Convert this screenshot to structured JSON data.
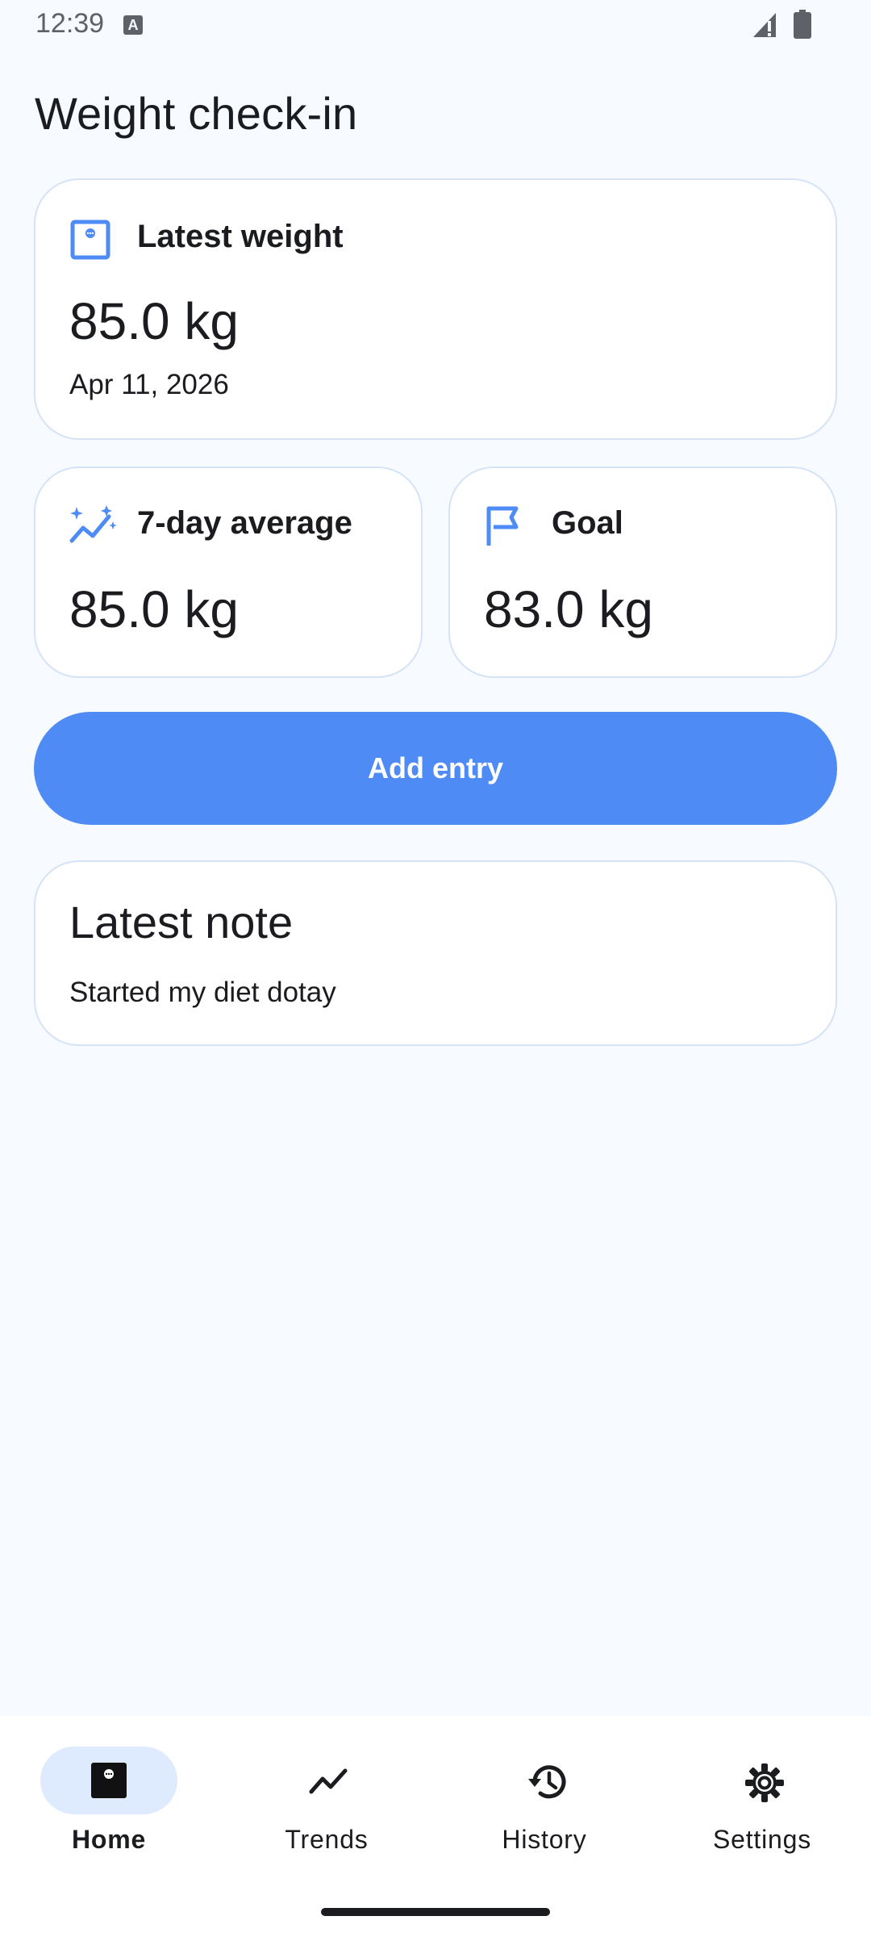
{
  "status_bar": {
    "time": "12:39",
    "notification_icon": "a-letter-icon",
    "signal_icon": "signal-icon",
    "battery_icon": "battery-icon"
  },
  "page": {
    "title": "Weight check-in"
  },
  "latest_weight": {
    "icon": "scale-icon",
    "label": "Latest weight",
    "value": "85.0 kg",
    "date": "Apr 11, 2026"
  },
  "seven_day_average": {
    "icon": "trend-sparkle-icon",
    "label": "7-day average",
    "value": "85.0 kg"
  },
  "goal": {
    "icon": "flag-icon",
    "label": "Goal",
    "value": "83.0 kg"
  },
  "add_entry": {
    "label": "Add entry"
  },
  "latest_note": {
    "title": "Latest note",
    "text": "Started my diet dotay"
  },
  "bottom_nav": {
    "items": [
      {
        "label": "Home",
        "icon": "scale-icon",
        "active": true
      },
      {
        "label": "Trends",
        "icon": "trend-line-icon",
        "active": false
      },
      {
        "label": "History",
        "icon": "history-icon",
        "active": false
      },
      {
        "label": "Settings",
        "icon": "gear-icon",
        "active": false
      }
    ]
  },
  "colors": {
    "background": "#f7faff",
    "accent": "#4e8bf5",
    "card_border": "#d6e3f7",
    "active_nav_pill": "#deebfe",
    "text": "#1b1c20"
  }
}
